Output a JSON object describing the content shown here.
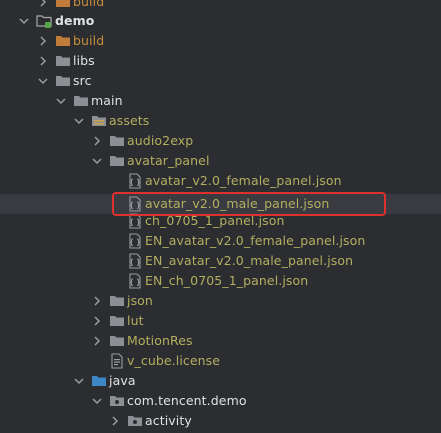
{
  "project_tree": {
    "items": [
      {
        "label": "build",
        "color": "#c78f3d"
      },
      {
        "label": "demo",
        "color": "#dfe1e5"
      },
      {
        "label": "build",
        "color": "#c78f3d"
      },
      {
        "label": "libs",
        "color": "#dfe1e5"
      },
      {
        "label": "src",
        "color": "#dfe1e5"
      },
      {
        "label": "main",
        "color": "#dfe1e5"
      },
      {
        "label": "assets",
        "color": "#b3ae60"
      },
      {
        "label": "audio2exp",
        "color": "#b3ae60"
      },
      {
        "label": "avatar_panel",
        "color": "#b3ae60"
      },
      {
        "label": "avatar_v2.0_female_panel.json",
        "color": "#b3ae60"
      },
      {
        "label": "avatar_v2.0_male_panel.json",
        "color": "#b3ae60"
      },
      {
        "label": "ch_0705_1_panel.json",
        "color": "#b3ae60"
      },
      {
        "label": "EN_avatar_v2.0_female_panel.json",
        "color": "#b3ae60"
      },
      {
        "label": "EN_avatar_v2.0_male_panel.json",
        "color": "#b3ae60"
      },
      {
        "label": "EN_ch_0705_1_panel.json",
        "color": "#b3ae60"
      },
      {
        "label": "json",
        "color": "#b3ae60"
      },
      {
        "label": "lut",
        "color": "#b3ae60"
      },
      {
        "label": "MotionRes",
        "color": "#b3ae60"
      },
      {
        "label": "v_cube.license",
        "color": "#b3ae60"
      },
      {
        "label": "java",
        "color": "#dfe1e5"
      },
      {
        "label": "com.tencent.demo",
        "color": "#dfe1e5"
      },
      {
        "label": "activity",
        "color": "#dfe1e5"
      }
    ],
    "highlight_color": "#e0302b"
  }
}
